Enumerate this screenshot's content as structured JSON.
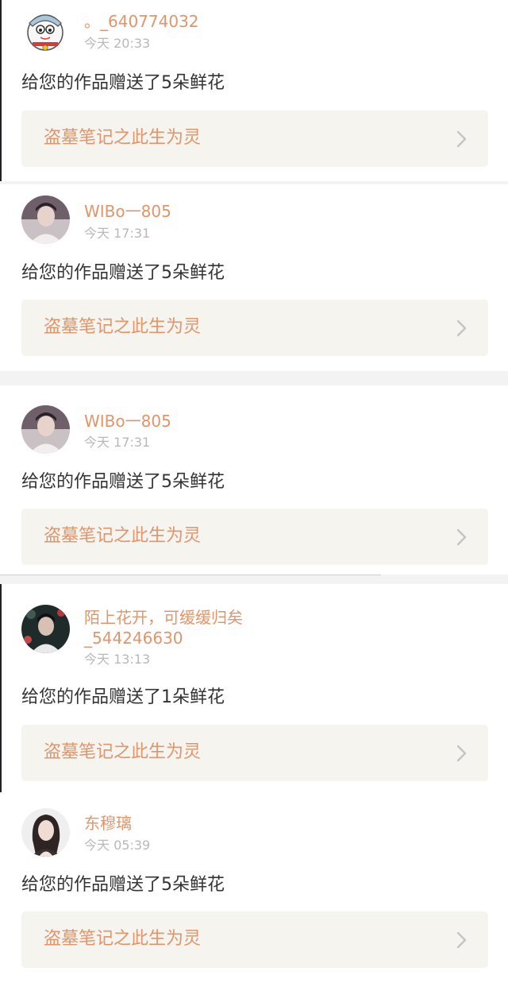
{
  "notifications": [
    {
      "user_name": "。_640774032",
      "time": "今天 20:33",
      "message": "给您的作品赠送了5朵鲜花",
      "work_title": "盗墓笔记之此生为灵",
      "avatar_icon": "cartoon-cat-avatar-icon"
    },
    {
      "user_name": "WIBo一805",
      "time": "今天 17:31",
      "message": "给您的作品赠送了5朵鲜花",
      "work_title": "盗墓笔记之此生为灵",
      "avatar_icon": "user-photo-avatar-icon"
    },
    {
      "user_name": "WIBo一805",
      "time": "今天 17:31",
      "message": "给您的作品赠送了5朵鲜花",
      "work_title": "盗墓笔记之此生为灵",
      "avatar_icon": "user-photo-avatar-icon"
    },
    {
      "user_name_line1": "陌上花开，可缓缓归矣",
      "user_name_line2": "_544246630",
      "time": "今天 13:13",
      "message": "给您的作品赠送了1朵鲜花",
      "work_title": "盗墓笔记之此生为灵",
      "avatar_icon": "user-photo-avatar-icon"
    },
    {
      "user_name": "东穆璃",
      "time": "今天 05:39",
      "message": "给您的作品赠送了5朵鲜花",
      "work_title": "盗墓笔记之此生为灵",
      "avatar_icon": "user-photo-avatar-icon"
    }
  ],
  "colors": {
    "name": "#e0956a",
    "time": "#b8b8b8",
    "message": "#333333",
    "link_bg": "#f5f4ef",
    "link_text": "#e0956a",
    "separator": "#f3f3f3"
  }
}
